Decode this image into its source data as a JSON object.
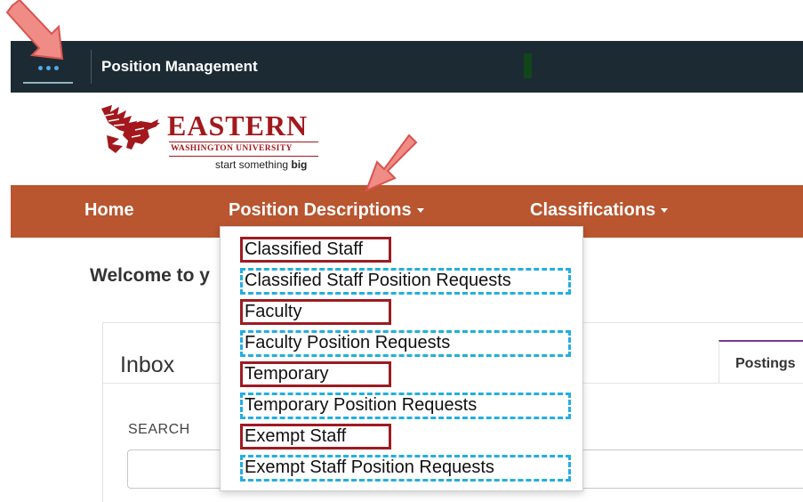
{
  "app_bar": {
    "title": "Position Management",
    "menu_icon": "ellipsis-icon"
  },
  "logo": {
    "name": "EASTERN",
    "university": "WASHINGTON UNIVERSITY",
    "tagline_plain": "start something ",
    "tagline_bold": "big"
  },
  "nav": {
    "home": "Home",
    "position_descriptions": "Position Descriptions",
    "classifications": "Classifications"
  },
  "dropdown": {
    "items": [
      {
        "label": "Classified Staff",
        "highlight": "red-solid"
      },
      {
        "label": "Classified Staff Position Requests",
        "highlight": "blue-dashed"
      },
      {
        "label": "Faculty",
        "highlight": "red-solid"
      },
      {
        "label": "Faculty Position Requests",
        "highlight": "blue-dashed"
      },
      {
        "label": "Temporary",
        "highlight": "red-solid"
      },
      {
        "label": "Temporary Position Requests",
        "highlight": "blue-dashed"
      },
      {
        "label": "Exempt Staff",
        "highlight": "red-solid"
      },
      {
        "label": "Exempt Staff Position Requests",
        "highlight": "blue-dashed"
      }
    ]
  },
  "main": {
    "welcome": "Welcome to y",
    "inbox_title": "Inbox",
    "postings_tab": "Postings",
    "search_label": "SEARCH",
    "search_value": ""
  },
  "colors": {
    "top_bar": "#1c2b33",
    "nav_bar": "#b9552f",
    "brand_red": "#a3181c",
    "annotation_red": "#9c1c22",
    "annotation_blue": "#23aee3",
    "arrow": "#ef8c86"
  }
}
